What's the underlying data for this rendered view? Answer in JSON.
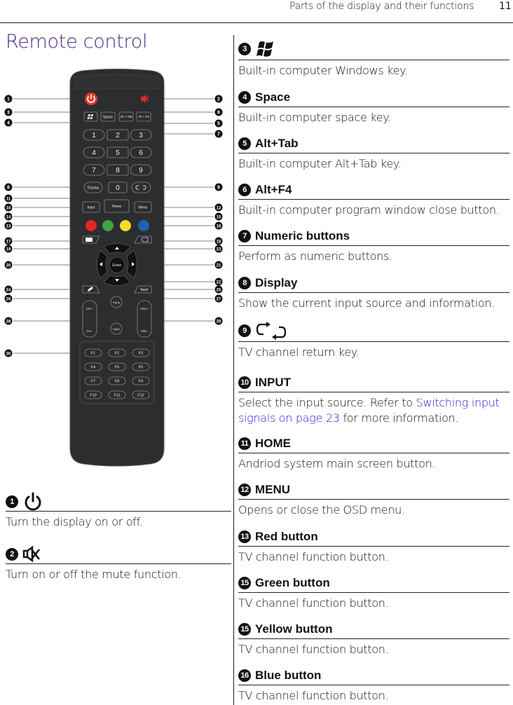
{
  "header": {
    "title": "Parts of the display and their functions",
    "page_number": "11"
  },
  "section_title": "Remote control",
  "colors": {
    "title_purple": "#4b2a86",
    "link_blue": "#1d1de0",
    "power_red": "#e03a2e",
    "key_red": "#e0252b",
    "key_green": "#3fa447",
    "key_yellow": "#f2db2a",
    "key_blue": "#1e62b0",
    "remote_body": "#2b2d2f"
  },
  "remote": {
    "keys": {
      "space": "Space",
      "alt_tab": "Alt + Tab",
      "alt_f4": "Alt + F4",
      "digits": [
        "1",
        "2",
        "3",
        "4",
        "5",
        "6",
        "7",
        "8",
        "9",
        "0"
      ],
      "display": "Display",
      "input": "Input",
      "home": "Home",
      "menu": "Menu",
      "enter": "Enter",
      "back": "Back",
      "pgup": "PgUp",
      "pgdn": "PgDn",
      "ch_plus": "CH.+",
      "ch_minus": "CH.-",
      "vol_plus": "VOL+",
      "vol_minus": "VOL-",
      "fkeys": [
        "F1",
        "F2",
        "F3",
        "F4",
        "F5",
        "F6",
        "F7",
        "F8",
        "F9",
        "F10",
        "F11",
        "F12"
      ]
    },
    "callouts_left": [
      "1",
      "3",
      "4",
      "8",
      "11",
      "10",
      "14",
      "13",
      "17",
      "19",
      "20",
      "24",
      "26",
      "28",
      "30"
    ],
    "callouts_right": [
      "2",
      "6",
      "5",
      "7",
      "9",
      "12",
      "15",
      "16",
      "18",
      "23",
      "21",
      "22",
      "25",
      "27",
      "29"
    ]
  },
  "entries_left": [
    {
      "num": "1",
      "icon": "power-icon",
      "desc": "Turn the display on or off."
    },
    {
      "num": "2",
      "icon": "mute-icon",
      "desc": "Turn on or off the mute function."
    }
  ],
  "entries_right": [
    {
      "num": "3",
      "icon": "windows-icon",
      "title": "",
      "desc": "Built-in computer Windows key."
    },
    {
      "num": "4",
      "title": "Space",
      "desc": "Built-in computer space key."
    },
    {
      "num": "5",
      "title": "Alt+Tab",
      "desc": "Built-in computer Alt+Tab key."
    },
    {
      "num": "6",
      "title": "Alt+F4",
      "desc": "Built-in computer program window close button."
    },
    {
      "num": "7",
      "title": "Numeric buttons",
      "desc": "Perform as numeric buttons."
    },
    {
      "num": "8",
      "title": "Display",
      "desc": "Show the current input source and information."
    },
    {
      "num": "9",
      "icon": "return-icon",
      "title": "",
      "desc": "TV channel return key."
    },
    {
      "num": "10",
      "title": "INPUT",
      "desc_before": "Select the input source. Refer to ",
      "desc_link": "Switching input signals on page 23",
      "desc_after": " for more information."
    },
    {
      "num": "11",
      "title": "HOME",
      "desc": "Andriod system main screen button."
    },
    {
      "num": "12",
      "title": "MENU",
      "desc": "Opens or close the OSD menu."
    },
    {
      "num": "13",
      "title": "Red button",
      "desc": "TV channel function button."
    },
    {
      "num": "15",
      "title": "Green button",
      "desc": "TV channel function button."
    },
    {
      "num": "15",
      "title": "Yellow button",
      "desc": "TV channel function button."
    },
    {
      "num": "16",
      "title": "Blue button",
      "desc": "TV channel function button."
    }
  ]
}
